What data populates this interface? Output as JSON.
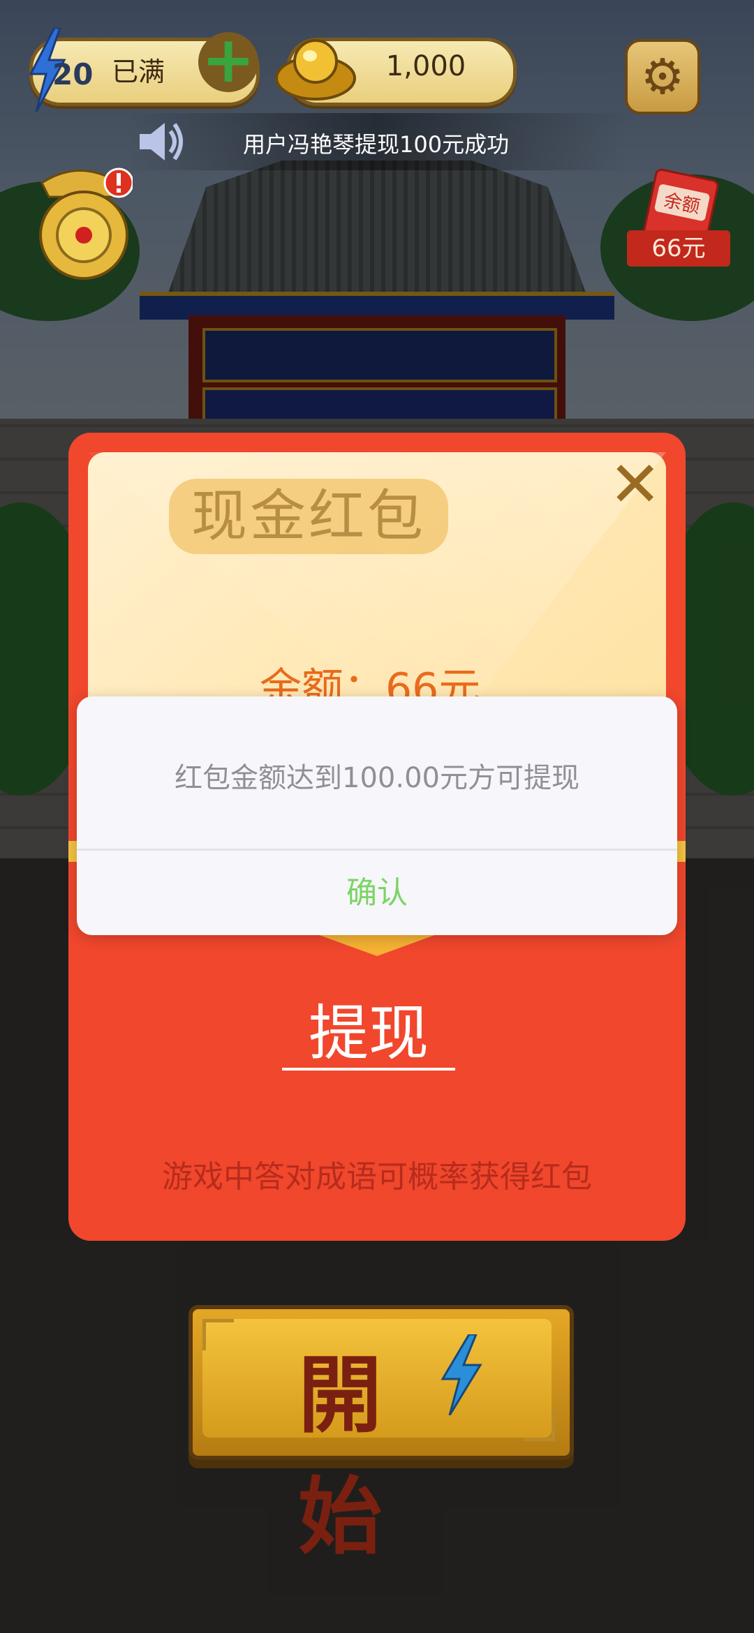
{
  "hud": {
    "energy_count": "20",
    "energy_status": "已满",
    "gold_amount": "1,000"
  },
  "ticker": {
    "message": "用户冯艳琴提现100元成功"
  },
  "side": {
    "balance_badge_label": "余额",
    "balance_badge_amount": "66元"
  },
  "modal": {
    "title": "现金红包",
    "balance_text": "余额：66元",
    "withdraw_label": "提现",
    "hint": "游戏中答对成语可概率获得红包"
  },
  "dialog": {
    "message": "红包金额达到100.00元方可提现",
    "confirm_label": "确认"
  },
  "start_button": {
    "label": "開始"
  },
  "colors": {
    "modal_red": "#f0472d",
    "confirm_green": "#7bd464",
    "gold": "#e9cf7d"
  }
}
